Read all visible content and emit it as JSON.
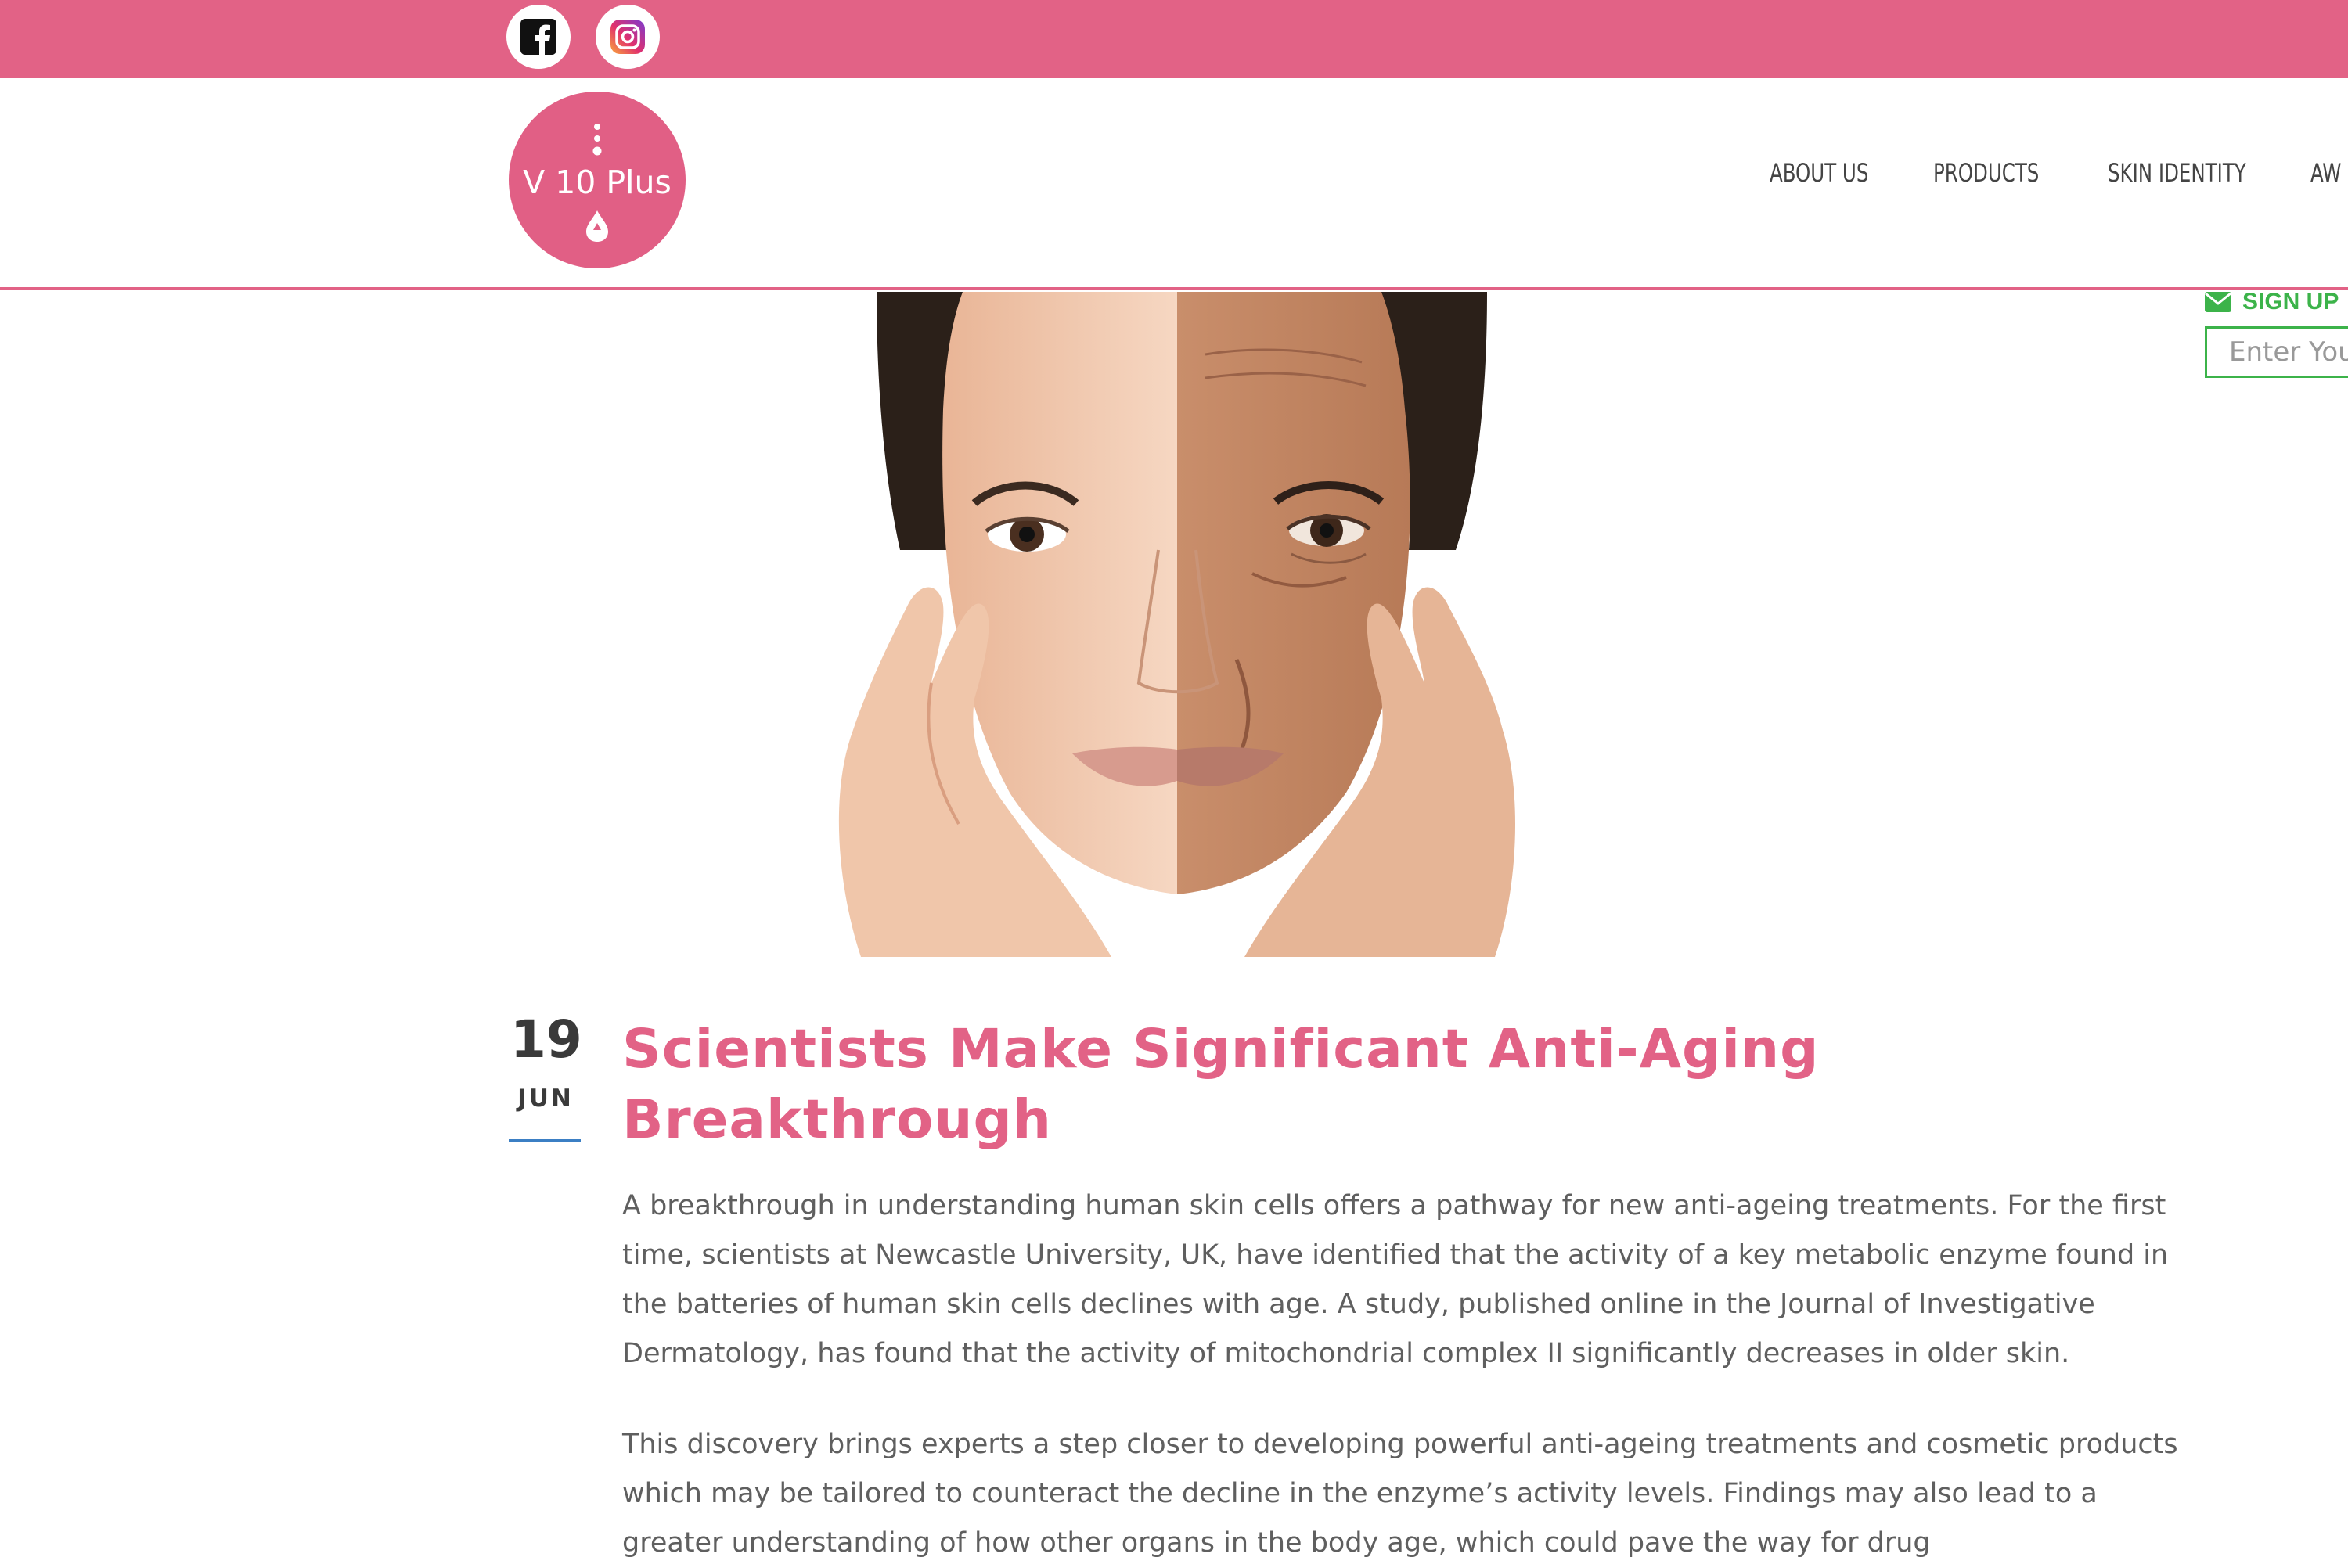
{
  "topbar": {
    "social": [
      {
        "icon": "facebook-icon",
        "label": "f"
      },
      {
        "icon": "instagram-icon"
      }
    ],
    "color": "#e26286"
  },
  "header": {
    "logo_text": "V 10 Plus",
    "nav": [
      "ABOUT US",
      "PRODUCTS",
      "SKIN IDENTITY",
      "AW"
    ]
  },
  "signup": {
    "label": "SIGN UP",
    "placeholder": "Enter Your"
  },
  "article": {
    "date_day": "19",
    "date_month": "JUN",
    "title": "Scientists Make Significant Anti-Aging Breakthrough",
    "paragraphs": [
      "A breakthrough in understanding human skin cells offers a pathway for new anti-ageing treatments. For the first time, scientists at Newcastle University, UK, have identified that the activity of a key metabolic enzyme found in the batteries of human skin cells declines with age. A study, published online in the Journal of Investigative Dermatology, has found that the activity of mitochondrial complex II significantly decreases in older skin.",
      "This discovery brings experts a step closer to developing powerful anti-ageing treatments and cosmetic products which may be tailored to counteract the decline in the enzyme’s activity levels. Findings may also lead to a greater understanding of how other organs in the body age, which could pave the way for drug"
    ]
  },
  "colors": {
    "brand_pink": "#e26286",
    "signup_green": "#3cb34a",
    "date_rule_blue": "#3b7fc4"
  }
}
